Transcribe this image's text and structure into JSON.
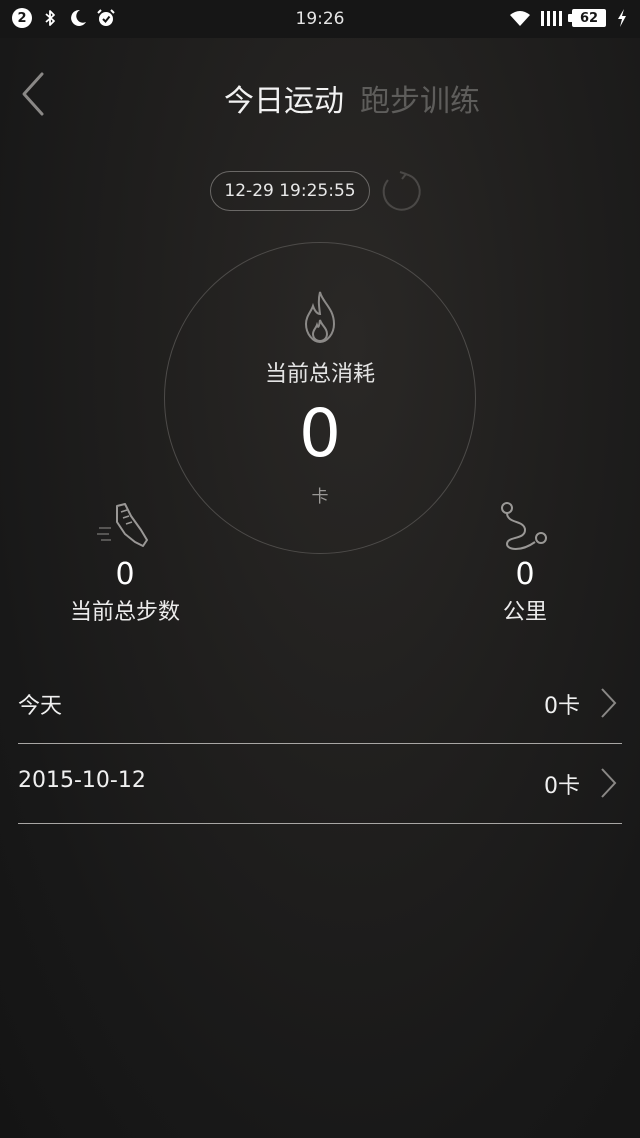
{
  "status_bar": {
    "notification_count": "2",
    "time": "19:26",
    "battery": "62"
  },
  "header": {
    "tab_active": "今日运动",
    "tab_inactive": "跑步训练"
  },
  "sync": {
    "timestamp": "12-29 19:25:55"
  },
  "calories": {
    "label": "当前总消耗",
    "value": "0",
    "unit": "卡"
  },
  "steps": {
    "value": "0",
    "label": "当前总步数"
  },
  "distance": {
    "value": "0",
    "label": "公里"
  },
  "history": [
    {
      "label": "今天",
      "value": "0卡"
    },
    {
      "label": "2015-10-12",
      "value": "0卡"
    }
  ],
  "colors": {
    "background": "#1c1b1a",
    "text": "#ffffff",
    "inactive_tab": "#5e5d5b",
    "divider": "#a8a6a4"
  }
}
